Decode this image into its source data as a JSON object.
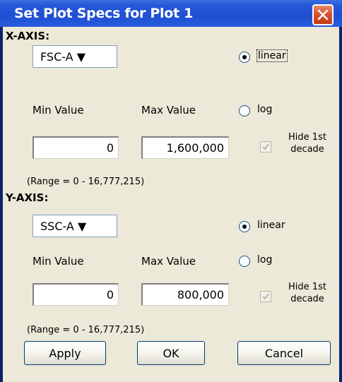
{
  "window": {
    "title": "Set Plot Specs for Plot 1"
  },
  "x_axis": {
    "heading": "X-AXIS:",
    "parameter": "FSC-A ▼",
    "min_label": "Min Value",
    "max_label": "Max Value",
    "min_value": "0",
    "max_value": "1,600,000",
    "scale_linear": "linear",
    "scale_log": "log",
    "selected_scale": "linear",
    "hide_decade_line1": "Hide 1st",
    "hide_decade_line2": "decade",
    "range_text": "(Range = 0 - 16,777,215)"
  },
  "y_axis": {
    "heading": "Y-AXIS:",
    "parameter": "SSC-A ▼",
    "min_label": "Min Value",
    "max_label": "Max Value",
    "min_value": "0",
    "max_value": "800,000",
    "scale_linear": "linear",
    "scale_log": "log",
    "selected_scale": "linear",
    "hide_decade_line1": "Hide 1st",
    "hide_decade_line2": "decade",
    "range_text": "(Range = 0 - 16,777,215)"
  },
  "buttons": {
    "apply": "Apply",
    "ok": "OK",
    "cancel": "Cancel"
  },
  "colors": {
    "titlebar": "#1e4fd0",
    "dialog_bg": "#ece9d8",
    "close_button": "#d9532e"
  }
}
